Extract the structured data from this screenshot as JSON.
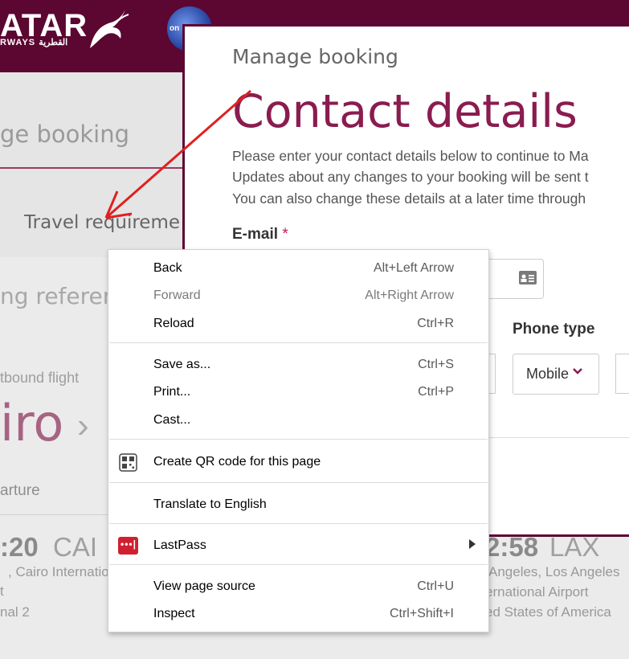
{
  "header": {
    "logo_main": "ATAR",
    "logo_sub": "RWAYS القطرية",
    "alliance_badge": "on"
  },
  "background_page": {
    "title": "ge booking",
    "travel_requirements": "Travel requireme",
    "booking_reference": "ng referenc",
    "outbound_label": "tbound flight",
    "origin_city": "iro",
    "chevron": "›",
    "departure_label": "arture",
    "dep_time": ":20",
    "dep_code": "CAI",
    "dep_line1": ", Cairo Internatio",
    "dep_line2": "t",
    "dep_line3": "nal 2",
    "arr_time": "2:58",
    "arr_code": "LAX",
    "arr_line1": "Angeles, Los Angeles",
    "arr_line2": "ernational Airport",
    "arr_line3": "ed States of America"
  },
  "modal": {
    "breadcrumb": "Manage booking",
    "title": "Contact details",
    "paragraph": [
      "Please enter your contact details below to continue to Ma",
      "Updates about any changes to your booking will be sent t",
      "You can also change these details at a later time through"
    ],
    "email_label": "E-mail",
    "required_mark": "*",
    "phone_type_label": "Phone type",
    "phone_type_value": "Mobile",
    "accent_color": "#8a1c4f"
  },
  "context_menu": {
    "groups": [
      [
        {
          "label": "Back",
          "shortcut": "Alt+Left Arrow",
          "disabled": false
        },
        {
          "label": "Forward",
          "shortcut": "Alt+Right Arrow",
          "disabled": true
        },
        {
          "label": "Reload",
          "shortcut": "Ctrl+R",
          "disabled": false
        }
      ],
      [
        {
          "label": "Save as...",
          "shortcut": "Ctrl+S",
          "disabled": false
        },
        {
          "label": "Print...",
          "shortcut": "Ctrl+P",
          "disabled": false
        },
        {
          "label": "Cast...",
          "shortcut": "",
          "disabled": false
        }
      ],
      [
        {
          "label": "Create QR code for this page",
          "shortcut": "",
          "icon": "qr-code-icon"
        }
      ],
      [
        {
          "label": "Translate to English",
          "shortcut": ""
        }
      ],
      [
        {
          "label": "LastPass",
          "shortcut": "",
          "icon": "lastpass-icon",
          "icon_text": "•••|",
          "submenu": true
        }
      ],
      [
        {
          "label": "View page source",
          "shortcut": "Ctrl+U"
        },
        {
          "label": "Inspect",
          "shortcut": "Ctrl+Shift+I"
        }
      ]
    ]
  },
  "colors": {
    "brand": "#5c0632",
    "annotation_arrow": "#e02020"
  }
}
